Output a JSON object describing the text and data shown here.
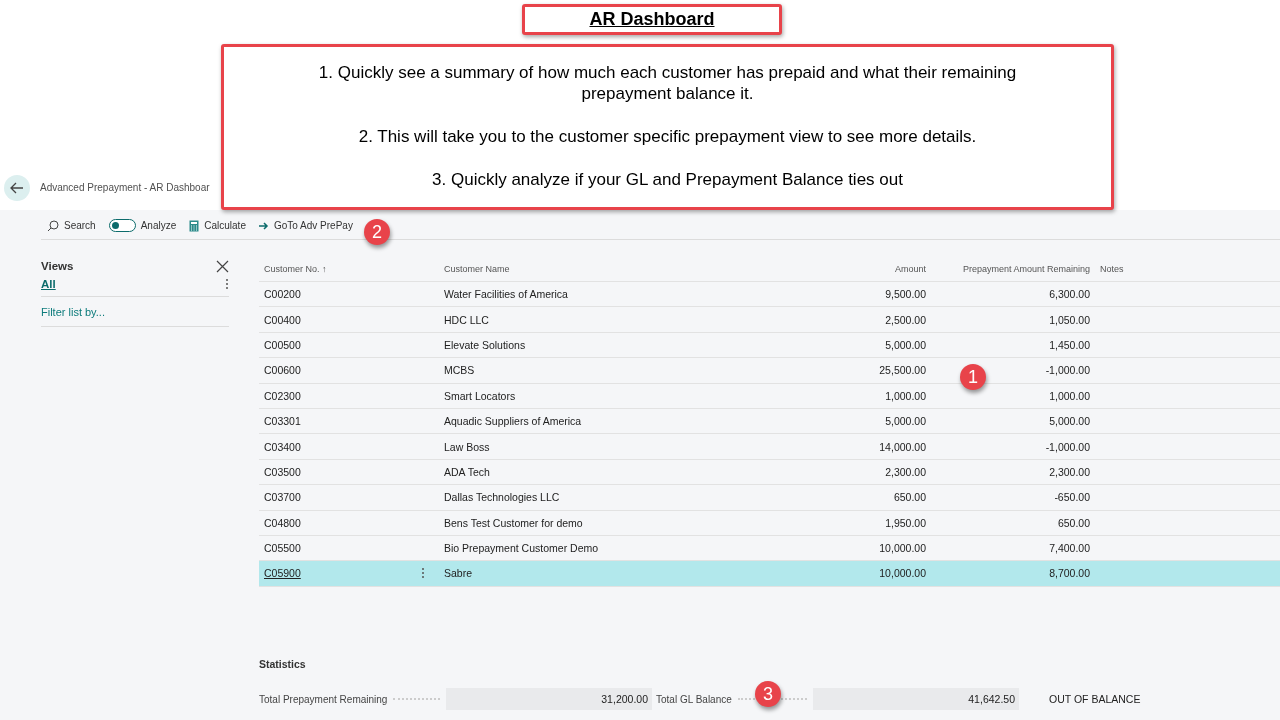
{
  "annotation_title": "AR Dashboard",
  "annotation_notes": [
    "1. Quickly see a summary of how much each customer has prepaid and what their remaining prepayment balance it.",
    "2. This will take you to the customer specific prepayment view to see more details.",
    "3. Quickly analyze if your GL and Prepayment Balance ties out"
  ],
  "markers": [
    "1",
    "2",
    "3"
  ],
  "breadcrumb": "Advanced Prepayment - AR Dashboar",
  "toolbar": [
    {
      "kind": "search",
      "label": "Search"
    },
    {
      "kind": "toggle",
      "label": "Analyze",
      "on": false
    },
    {
      "kind": "calculate",
      "label": "Calculate"
    },
    {
      "kind": "goto",
      "label": "GoTo Adv PrePay"
    }
  ],
  "views": {
    "title": "Views",
    "items": [
      {
        "label": "All",
        "selected": true
      }
    ],
    "filter": "Filter list by..."
  },
  "table": {
    "columns": [
      "Customer No.",
      "Customer Name",
      "Amount",
      "Prepayment Amount Remaining",
      "Notes"
    ],
    "sort_mark": "↑",
    "rows": [
      {
        "no": "C00200",
        "name": "Water Facilities of America",
        "amount": "9,500.00",
        "remaining": "6,300.00",
        "selected": false
      },
      {
        "no": "C00400",
        "name": "HDC LLC",
        "amount": "2,500.00",
        "remaining": "1,050.00",
        "selected": false
      },
      {
        "no": "C00500",
        "name": "Elevate Solutions",
        "amount": "5,000.00",
        "remaining": "1,450.00",
        "selected": false
      },
      {
        "no": "C00600",
        "name": "MCBS",
        "amount": "25,500.00",
        "remaining": "-1,000.00",
        "selected": false
      },
      {
        "no": "C02300",
        "name": "Smart Locators",
        "amount": "1,000.00",
        "remaining": "1,000.00",
        "selected": false
      },
      {
        "no": "C03301",
        "name": "Aquadic Suppliers of America",
        "amount": "5,000.00",
        "remaining": "5,000.00",
        "selected": false
      },
      {
        "no": "C03400",
        "name": "Law Boss",
        "amount": "14,000.00",
        "remaining": "-1,000.00",
        "selected": false
      },
      {
        "no": "C03500",
        "name": "ADA Tech",
        "amount": "2,300.00",
        "remaining": "2,300.00",
        "selected": false
      },
      {
        "no": "C03700",
        "name": "Dallas Technologies LLC",
        "amount": "650.00",
        "remaining": "-650.00",
        "selected": false
      },
      {
        "no": "C04800",
        "name": "Bens Test Customer for demo",
        "amount": "1,950.00",
        "remaining": "650.00",
        "selected": false
      },
      {
        "no": "C05500",
        "name": "Bio Prepayment Customer Demo",
        "amount": "10,000.00",
        "remaining": "7,400.00",
        "selected": false
      },
      {
        "no": "C05900",
        "name": "Sabre",
        "amount": "10,000.00",
        "remaining": "8,700.00",
        "selected": true
      }
    ]
  },
  "statistics": {
    "title": "Statistics",
    "fields": [
      {
        "label": "Total Prepayment Remaining",
        "value": "31,200.00"
      },
      {
        "label": "Total GL Balance",
        "value": "41,642.50"
      }
    ],
    "status": "OUT OF BALANCE"
  }
}
